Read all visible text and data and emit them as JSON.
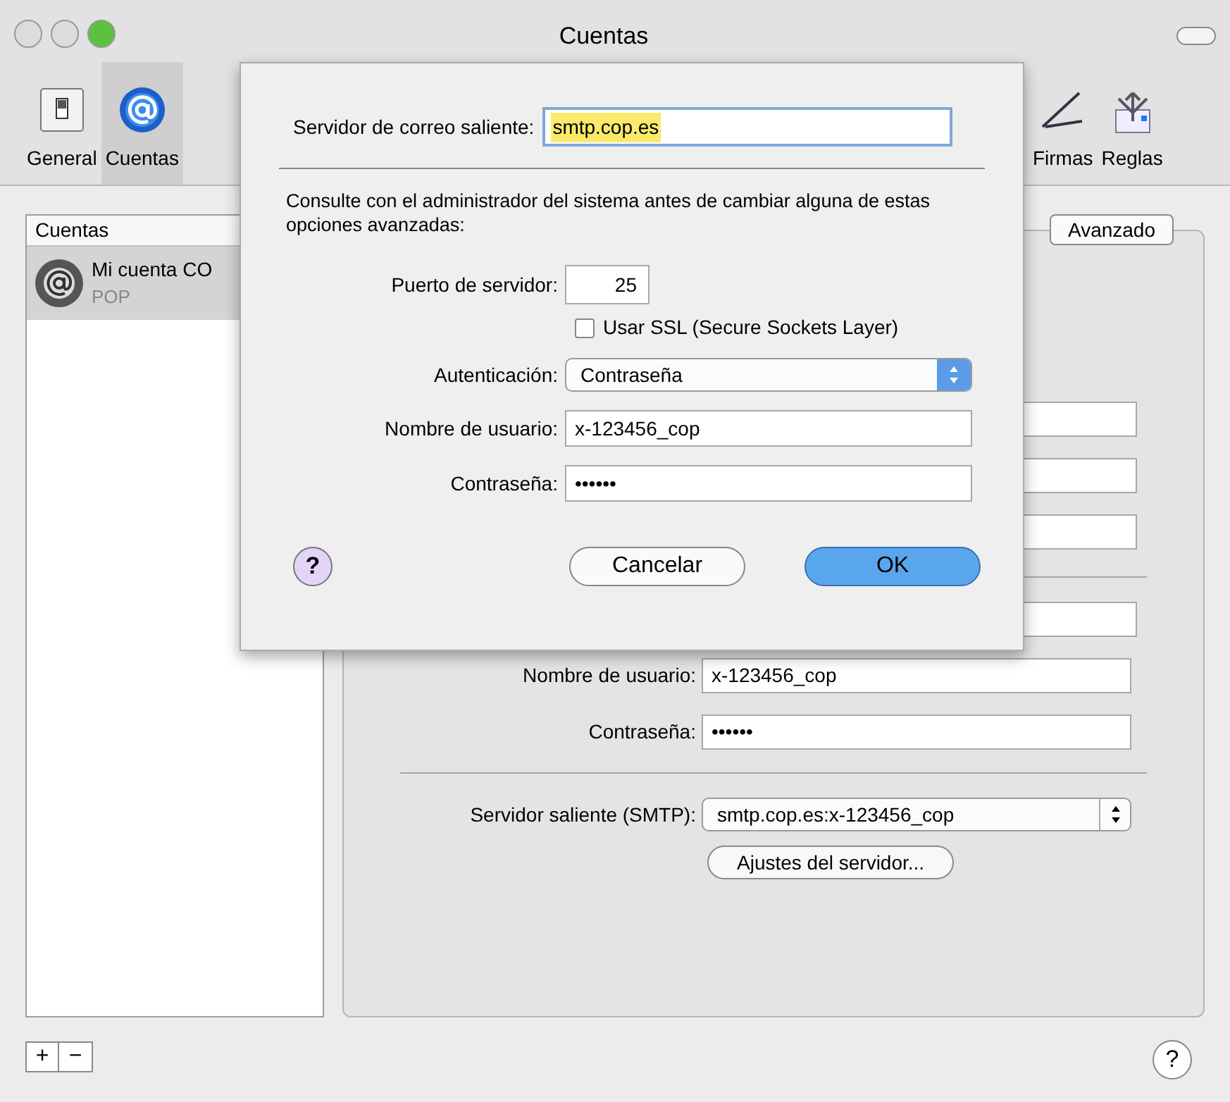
{
  "window": {
    "title": "Cuentas"
  },
  "toolbar": {
    "items": [
      {
        "label": "General",
        "selected": false
      },
      {
        "label": "Cuentas",
        "selected": true
      },
      {
        "label": "Firmas",
        "selected": false
      },
      {
        "label": "Reglas",
        "selected": false
      }
    ]
  },
  "accounts": {
    "header": "Cuentas",
    "items": [
      {
        "name": "Mi cuenta CO",
        "type": "POP",
        "selected": true
      }
    ]
  },
  "panel": {
    "tabs": [
      {
        "label": "Avanzado",
        "selected": true
      }
    ],
    "username": {
      "label": "Nombre de usuario:",
      "value": "x-123456_cop"
    },
    "password": {
      "label": "Contraseña:",
      "value": "••••••"
    },
    "smtp": {
      "label": "Servidor saliente (SMTP):",
      "value": "smtp.cop.es:x-123456_cop"
    },
    "server_button": "Ajustes del servidor..."
  },
  "sheet": {
    "server": {
      "label": "Servidor de correo saliente:",
      "value": "smtp.cop.es",
      "selected": true
    },
    "note": "Consulte con el administrador del sistema antes de cambiar alguna de estas opciones avanzadas:",
    "port": {
      "label": "Puerto de servidor:",
      "value": "25"
    },
    "ssl": {
      "label": "Usar SSL (Secure Sockets Layer)",
      "checked": false
    },
    "auth": {
      "label": "Autenticación:",
      "value": "Contraseña"
    },
    "username": {
      "label": "Nombre de usuario:",
      "value": "x-123456_cop"
    },
    "password": {
      "label": "Contraseña:",
      "value": "••••••"
    },
    "buttons": [
      {
        "label": "Cancelar",
        "default": false
      },
      {
        "label": "OK",
        "default": true
      }
    ]
  },
  "bottom": {
    "add": "+",
    "remove": "−",
    "help": "?"
  },
  "sheet_help": "?"
}
